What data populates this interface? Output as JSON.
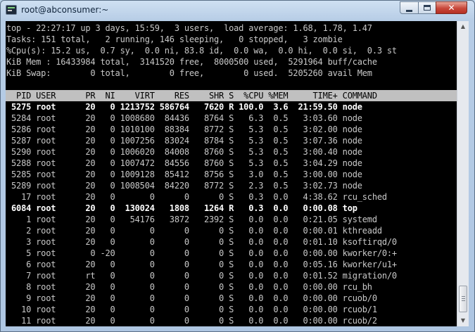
{
  "window": {
    "title": "root@abconsumer:~",
    "close_glyph": "✕"
  },
  "summary": [
    "top - 22:27:17 up 3 days, 15:59,  3 users,  load average: 1.68, 1.78, 1.47",
    "Tasks: 151 total,   2 running, 146 sleeping,   0 stopped,   3 zombie",
    "%Cpu(s): 15.2 us,  0.7 sy,  0.0 ni, 83.8 id,  0.0 wa,  0.0 hi,  0.0 si,  0.3 st",
    "KiB Mem : 16433984 total,  3141520 free,  8000500 used,  5291964 buff/cache",
    "KiB Swap:        0 total,        0 free,        0 used.  5205260 avail Mem"
  ],
  "table": {
    "header": "  PID USER      PR  NI    VIRT    RES    SHR S  %CPU %MEM     TIME+ COMMAND     ",
    "rows": [
      " 5275 root      20   0 1213752 586764   7620 R 100.0  3.6  21:59.50 node",
      " 5284 root      20   0 1008680  84436   8764 S   6.3  0.5   3:03.60 node",
      " 5286 root      20   0 1010100  88384   8772 S   5.3  0.5   3:02.00 node",
      " 5287 root      20   0 1007256  83024   8784 S   5.3  0.5   3:07.36 node",
      " 5290 root      20   0 1006020  84008   8760 S   5.3  0.5   3:00.40 node",
      " 5288 root      20   0 1007472  84556   8760 S   5.3  0.5   3:04.29 node",
      " 5285 root      20   0 1009128  85412   8756 S   3.0  0.5   3:00.00 node",
      " 5289 root      20   0 1008504  84220   8772 S   2.3  0.5   3:02.73 node",
      "   17 root      20   0       0      0      0 S   0.3  0.0   4:38.62 rcu_sched",
      " 6084 root      20   0  130024   1808   1264 R   0.3  0.0   0:00.08 top",
      "    1 root      20   0   54176   3872   2392 S   0.0  0.0   0:21.05 systemd",
      "    2 root      20   0       0      0      0 S   0.0  0.0   0:00.01 kthreadd",
      "    3 root      20   0       0      0      0 S   0.0  0.0   0:01.10 ksoftirqd/0",
      "    5 root       0 -20       0      0      0 S   0.0  0.0   0:00.00 kworker/0:+",
      "    6 root      20   0       0      0      0 S   0.0  0.0   0:05.16 kworker/u1+",
      "    7 root      rt   0       0      0      0 S   0.0  0.0   0:01.52 migration/0",
      "    8 root      20   0       0      0      0 S   0.0  0.0   0:00.00 rcu_bh",
      "    9 root      20   0       0      0      0 S   0.0  0.0   0:00.00 rcuob/0",
      "   10 root      20   0       0      0      0 S   0.0  0.0   0:00.00 rcuob/1",
      "   11 root      20   0       0      0      0 S   0.0  0.0   0:00.00 rcuob/2"
    ],
    "highlighted_rows": [
      0,
      9
    ]
  },
  "colors": {
    "terminal_bg": "#000000",
    "terminal_fg": "#c8c8c8",
    "header_bg": "#c0c0c0",
    "highlight_fg": "#ffffff"
  }
}
